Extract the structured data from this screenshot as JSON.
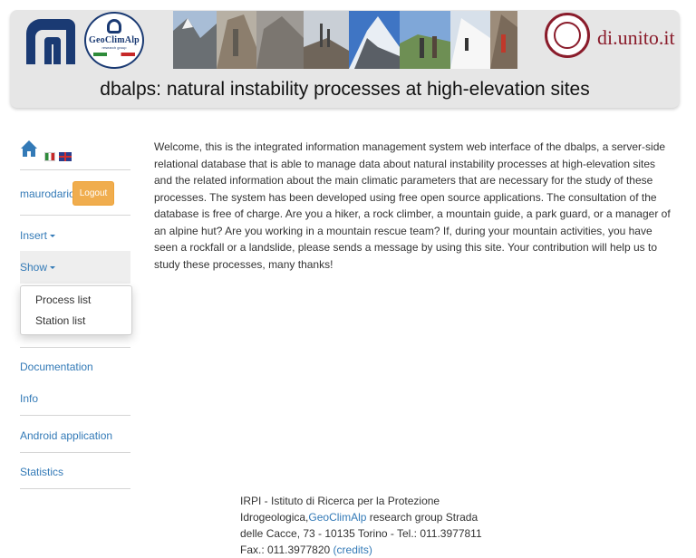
{
  "header": {
    "title": "dbalps: natural instability processes at high-elevation sites",
    "logos": {
      "cnr": "cnr-logo",
      "geoclimalp_name": "GeoClimAlp",
      "geoclimalp_sub": "research group",
      "unito": "di.unito.it"
    }
  },
  "sidebar": {
    "home_icon": "home-icon",
    "languages": [
      "it-flag",
      "uk-flag"
    ],
    "user": "maurodario",
    "logout_label": "Logout",
    "insert_label": "Insert",
    "show_label": "Show",
    "show_menu": [
      "Process list",
      "Station list"
    ],
    "documentation_label": "Documentation",
    "info_label": "Info",
    "android_label": "Android application",
    "statistics_label": "Statistics"
  },
  "main": {
    "welcome_text": "Welcome, this is the integrated information management system web interface of the dbalps, a server-side relational database that is able to manage data about natural instability processes at high-elevation sites and the related information about the main climatic parameters that are necessary for the study of these processes. The system has been developed using free open source applications. The consultation of the database is free of charge. Are you a hiker, a rock climber, a mountain guide, a park guard, or a manager of an alpine hut? Are you working in a mountain rescue team? If, during your mountain activities, you have seen a rockfall or a landslide, please sends a message by using this site. Your contribution will help us to study these processes, many thanks!"
  },
  "footer": {
    "text_1": "IRPI - Istituto di Ricerca per la Protezione Idrogeologica,",
    "link_geoclimalp": "GeoClimAlp",
    "text_2": " research group Strada delle Cacce, 73 - 10135 Torino - Tel.: 011.3977811 Fax.: 011.3977820 ",
    "link_credits": "(credits)"
  },
  "colors": {
    "link": "#337ab7",
    "logout_button": "#f0ad4e",
    "header_bg": "#e6e6e6",
    "unito": "#8a1c2b"
  }
}
